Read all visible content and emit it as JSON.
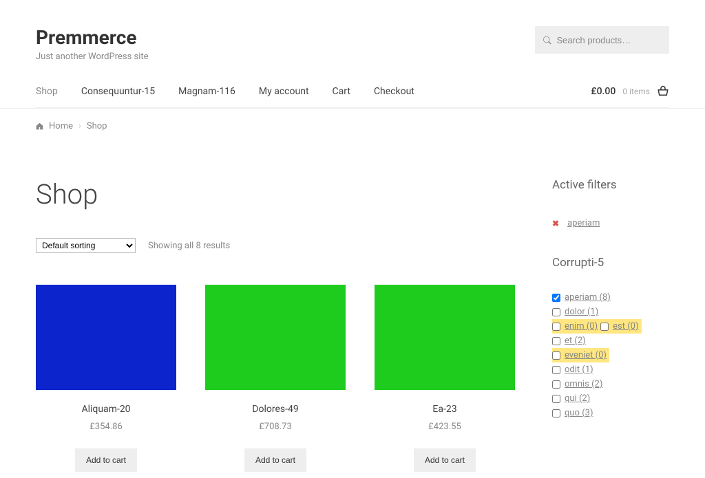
{
  "header": {
    "brand_title": "Premmerce",
    "brand_tagline": "Just another WordPress site",
    "search_placeholder": "Search products…"
  },
  "nav": {
    "items": [
      "Shop",
      "Consequuntur-15",
      "Magnam-116",
      "My account",
      "Cart",
      "Checkout"
    ],
    "cart_price": "£0.00",
    "cart_items": "0 items"
  },
  "breadcrumb": {
    "home": "Home",
    "current": "Shop"
  },
  "shop": {
    "title": "Shop",
    "sort_selected": "Default sorting",
    "result_count": "Showing all 8 results",
    "add_to_cart_label": "Add to cart",
    "products": [
      {
        "name": "Aliquam-20",
        "price": "£354.86",
        "color": "#0b24cc"
      },
      {
        "name": "Dolores-49",
        "price": "£708.73",
        "color": "#1ecc1e"
      },
      {
        "name": "Ea-23",
        "price": "£423.55",
        "color": "#1ecc1e"
      }
    ]
  },
  "sidebar": {
    "active_filters_title": "Active filters",
    "active_filter": "aperiam",
    "filter_group_title": "Corrupti-5",
    "filters": [
      {
        "label": "aperiam (8)",
        "checked": true,
        "highlight": false
      },
      {
        "label": "dolor (1)",
        "checked": false,
        "highlight": false
      },
      {
        "label": "enim (0)",
        "checked": false,
        "highlight": true
      },
      {
        "label": "est (0)",
        "checked": false,
        "highlight": true
      },
      {
        "label": "et (2)",
        "checked": false,
        "highlight": false
      },
      {
        "label": "eveniet (0)",
        "checked": false,
        "highlight": true
      },
      {
        "label": "odit (1)",
        "checked": false,
        "highlight": false
      },
      {
        "label": "omnis (2)",
        "checked": false,
        "highlight": false
      },
      {
        "label": "qui (2)",
        "checked": false,
        "highlight": false
      },
      {
        "label": "quo (3)",
        "checked": false,
        "highlight": false
      }
    ]
  }
}
